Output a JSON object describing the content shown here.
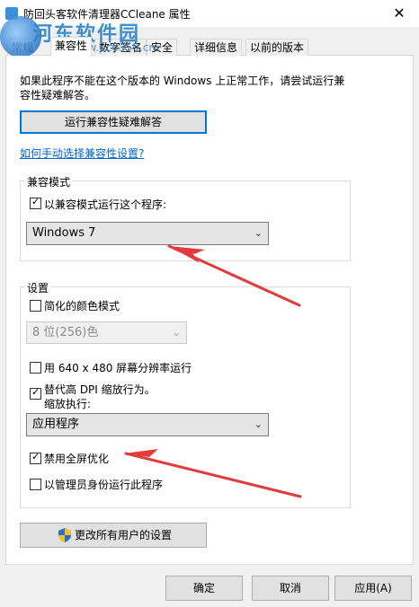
{
  "window": {
    "title": "防回头客软件清理器CCleane 属性",
    "close_glyph": "✕"
  },
  "watermark": {
    "brand": "河东软件园",
    "url": "www.pc0359.cn"
  },
  "tabs": [
    {
      "label": "常规"
    },
    {
      "label": "兼容性"
    },
    {
      "label": "数字签名"
    },
    {
      "label": "安全"
    },
    {
      "label": "详细信息"
    },
    {
      "label": "以前的版本"
    }
  ],
  "compat": {
    "intro_line1": "如果此程序不能在这个版本的 Windows 上正常工作，请尝试运行兼",
    "intro_line2": "容性疑难解答。",
    "troubleshooter_button": "运行兼容性疑难解答",
    "manual_link": "如何手动选择兼容性设置?"
  },
  "compat_mode": {
    "legend": "兼容模式",
    "checkbox_label": "以兼容模式运行这个程序:",
    "checked": true,
    "selected_os": "Windows 7"
  },
  "settings": {
    "legend": "设置",
    "reduced_color_label": "简化的颜色模式",
    "reduced_color_checked": false,
    "color_depth_value": "8 位(256)色",
    "res_640_label": "用 640 x 480 屏幕分辨率运行",
    "res_640_checked": false,
    "dpi_label": "替代高 DPI 缩放行为。",
    "dpi_checked": true,
    "scaling_by_label": "缩放执行:",
    "scaling_value": "应用程序",
    "fullscreen_opt_label": "禁用全屏优化",
    "fullscreen_opt_checked": true,
    "run_admin_label": "以管理员身份运行此程序",
    "run_admin_checked": false
  },
  "all_users_button": "更改所有用户的设置",
  "buttons": {
    "ok": "确定",
    "cancel": "取消",
    "apply": "应用(A)"
  },
  "icons": {
    "checked_glyph": "✓",
    "dropdown_glyph": "⌄"
  }
}
